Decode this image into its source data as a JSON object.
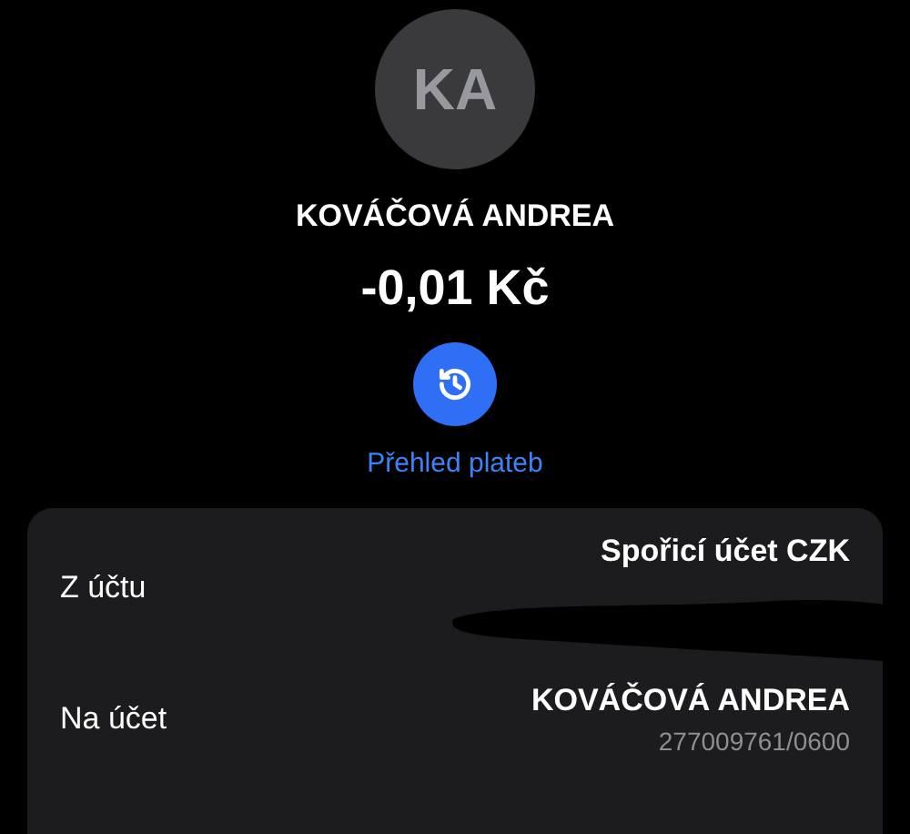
{
  "avatar": {
    "initials": "KA"
  },
  "name": "KOVÁČOVÁ ANDREA",
  "amount": "-0,01 Kč",
  "history": {
    "label": "Přehled plateb"
  },
  "details": [
    {
      "label": "Z účtu",
      "value": "Spořicí účet CZK",
      "redacted": true
    },
    {
      "label": "Na účet",
      "value": "KOVÁČOVÁ ANDREA",
      "sub": "277009761/0600",
      "redacted": false
    }
  ]
}
